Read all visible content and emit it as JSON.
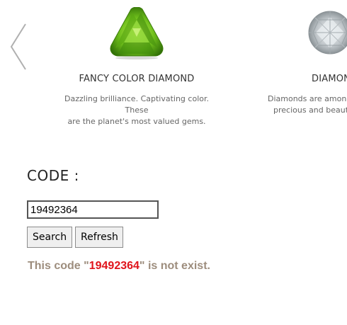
{
  "carousel": {
    "slides": [
      {
        "title": "FANCY COLOR DIAMOND",
        "description_line1": "Dazzling brilliance. Captivating color. These",
        "description_line2": "are the planet's most valued gems.",
        "image": "green-trillion-gem-icon"
      },
      {
        "title": "DIAMON",
        "description_line1": "Diamonds are among",
        "description_line2": "precious and beauti",
        "image": "white-round-diamond-icon"
      }
    ],
    "prev_icon": "chevron-left-icon"
  },
  "form": {
    "label": "CODE :",
    "input_value": "19492364",
    "search_label": "Search",
    "refresh_label": "Refresh"
  },
  "result": {
    "prefix": "This code \"",
    "code": "19492364",
    "suffix": "\" is not exist."
  },
  "colors": {
    "result_text": "#9d8d7d",
    "result_code": "#e0141b",
    "gem_green": "#5aa812"
  }
}
